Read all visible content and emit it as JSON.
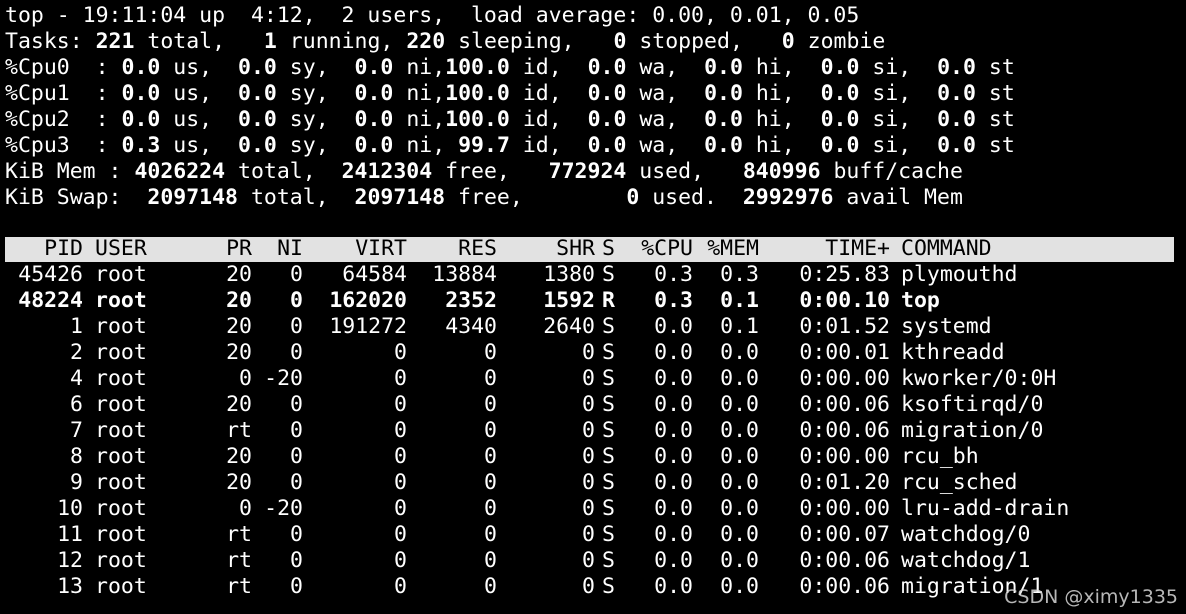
{
  "summary": {
    "uptime": [
      "top - 19:11:04 up  4:12,  2 users,  load average: 0.00, 0.01, 0.05"
    ],
    "tasks": [
      "Tasks: ",
      "221",
      " total,   ",
      "1",
      " running, ",
      "220",
      " sleeping,   ",
      "0",
      " stopped,   ",
      "0",
      " zombie"
    ],
    "cpu0": [
      "%Cpu0  : ",
      "0.0",
      " us,  ",
      "0.0",
      " sy,  ",
      "0.0",
      " ni,",
      "100.0",
      " id,  ",
      "0.0",
      " wa,  ",
      "0.0",
      " hi,  ",
      "0.0",
      " si,  ",
      "0.0",
      " st"
    ],
    "cpu1": [
      "%Cpu1  : ",
      "0.0",
      " us,  ",
      "0.0",
      " sy,  ",
      "0.0",
      " ni,",
      "100.0",
      " id,  ",
      "0.0",
      " wa,  ",
      "0.0",
      " hi,  ",
      "0.0",
      " si,  ",
      "0.0",
      " st"
    ],
    "cpu2": [
      "%Cpu2  : ",
      "0.0",
      " us,  ",
      "0.0",
      " sy,  ",
      "0.0",
      " ni,",
      "100.0",
      " id,  ",
      "0.0",
      " wa,  ",
      "0.0",
      " hi,  ",
      "0.0",
      " si,  ",
      "0.0",
      " st"
    ],
    "cpu3": [
      "%Cpu3  : ",
      "0.3",
      " us,  ",
      "0.0",
      " sy,  ",
      "0.0",
      " ni, ",
      "99.7",
      " id,  ",
      "0.0",
      " wa,  ",
      "0.0",
      " hi,  ",
      "0.0",
      " si,  ",
      "0.0",
      " st"
    ],
    "mem": [
      "KiB Mem : ",
      "4026224",
      " total,  ",
      "2412304",
      " free,   ",
      "772924",
      " used,   ",
      "840996",
      " buff/cache"
    ],
    "swap": [
      "KiB Swap:  ",
      "2097148",
      " total,  ",
      "2097148",
      " free,        ",
      "0",
      " used.  ",
      "2992976",
      " avail Mem"
    ]
  },
  "table": {
    "columns": [
      "PID",
      "USER",
      "PR",
      "NI",
      "VIRT",
      "RES",
      "SHR",
      "S",
      "%CPU",
      "%MEM",
      "TIME+",
      "COMMAND"
    ],
    "rows": [
      [
        "45426",
        "root",
        "20",
        "0",
        "64584",
        "13884",
        "1380",
        "S",
        "0.3",
        "0.3",
        "0:25.83",
        "plymouthd"
      ],
      [
        "48224",
        "root",
        "20",
        "0",
        "162020",
        "2352",
        "1592",
        "R",
        "0.3",
        "0.1",
        "0:00.10",
        "top"
      ],
      [
        "1",
        "root",
        "20",
        "0",
        "191272",
        "4340",
        "2640",
        "S",
        "0.0",
        "0.1",
        "0:01.52",
        "systemd"
      ],
      [
        "2",
        "root",
        "20",
        "0",
        "0",
        "0",
        "0",
        "S",
        "0.0",
        "0.0",
        "0:00.01",
        "kthreadd"
      ],
      [
        "4",
        "root",
        "0",
        "-20",
        "0",
        "0",
        "0",
        "S",
        "0.0",
        "0.0",
        "0:00.00",
        "kworker/0:0H"
      ],
      [
        "6",
        "root",
        "20",
        "0",
        "0",
        "0",
        "0",
        "S",
        "0.0",
        "0.0",
        "0:00.06",
        "ksoftirqd/0"
      ],
      [
        "7",
        "root",
        "rt",
        "0",
        "0",
        "0",
        "0",
        "S",
        "0.0",
        "0.0",
        "0:00.06",
        "migration/0"
      ],
      [
        "8",
        "root",
        "20",
        "0",
        "0",
        "0",
        "0",
        "S",
        "0.0",
        "0.0",
        "0:00.00",
        "rcu_bh"
      ],
      [
        "9",
        "root",
        "20",
        "0",
        "0",
        "0",
        "0",
        "S",
        "0.0",
        "0.0",
        "0:01.20",
        "rcu_sched"
      ],
      [
        "10",
        "root",
        "0",
        "-20",
        "0",
        "0",
        "0",
        "S",
        "0.0",
        "0.0",
        "0:00.00",
        "lru-add-drain"
      ],
      [
        "11",
        "root",
        "rt",
        "0",
        "0",
        "0",
        "0",
        "S",
        "0.0",
        "0.0",
        "0:00.07",
        "watchdog/0"
      ],
      [
        "12",
        "root",
        "rt",
        "0",
        "0",
        "0",
        "0",
        "S",
        "0.0",
        "0.0",
        "0:00.06",
        "watchdog/1"
      ],
      [
        "13",
        "root",
        "rt",
        "0",
        "0",
        "0",
        "0",
        "S",
        "0.0",
        "0.0",
        "0:00.06",
        "migration/1"
      ]
    ],
    "highlighted_row": 1
  },
  "watermark": "CSDN @ximy1335",
  "colors": {
    "background": "#000000",
    "text": "#ffffff",
    "header_bar": "#e2e2e2",
    "header_text": "#000000"
  }
}
